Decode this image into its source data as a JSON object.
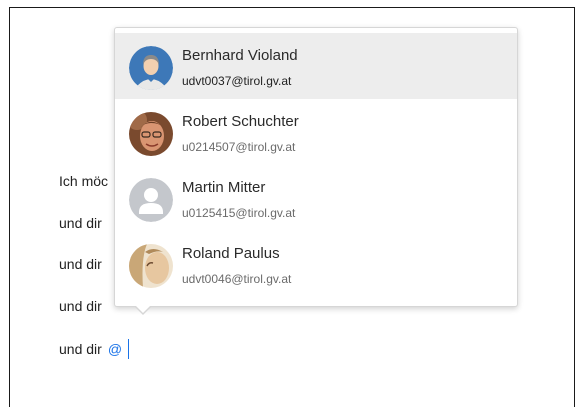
{
  "editor": {
    "lines": [
      {
        "text": "Ich möc"
      },
      {
        "text": "und dir"
      },
      {
        "text": "und dir"
      },
      {
        "text": "und dir"
      },
      {
        "text": "und dir",
        "mention_trigger": "@"
      }
    ]
  },
  "mention_popup": {
    "users": [
      {
        "name": "Bernhard Violand",
        "email": "udvt0037@tirol.gv.at",
        "avatar": "default-male-avatar-icon",
        "selected": true
      },
      {
        "name": "Robert Schuchter",
        "email": "u0214507@tirol.gv.at",
        "avatar": "photo-avatar",
        "selected": false
      },
      {
        "name": "Martin Mitter",
        "email": "u0125415@tirol.gv.at",
        "avatar": "placeholder-person-icon",
        "selected": false
      },
      {
        "name": "Roland Paulus",
        "email": "udvt0046@tirol.gv.at",
        "avatar": "photo-avatar",
        "selected": false
      }
    ]
  },
  "colors": {
    "accent": "#1a73e8",
    "selected_row": "#ededed",
    "avatar_blue": "#3d78b8",
    "placeholder_gray": "#c4c7cc"
  }
}
